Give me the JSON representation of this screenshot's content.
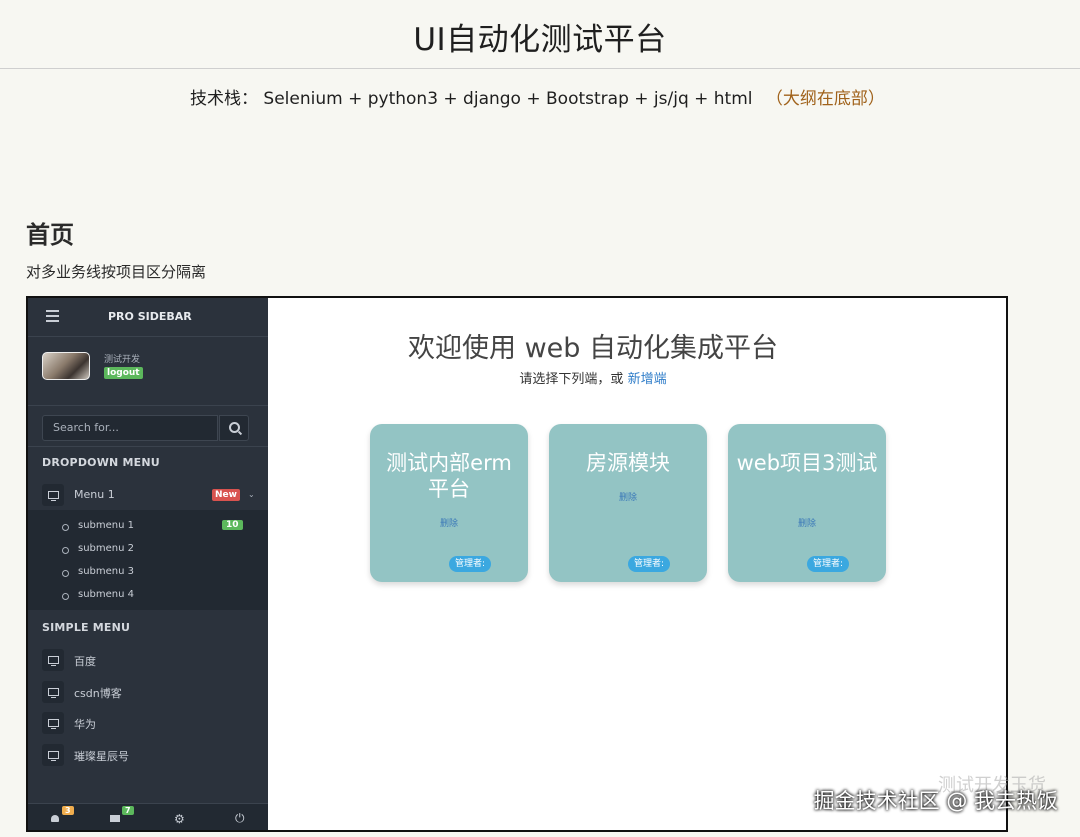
{
  "header": {
    "title": "UI自动化测试平台",
    "tech_label": "技术栈：",
    "tech_stack": "Selenium + python3 + django + Bootstrap + js/jq + html",
    "tech_note": "（大纲在底部）"
  },
  "section": {
    "heading": "首页",
    "description": "对多业务线按项目区分隔离"
  },
  "sidebar": {
    "brand": "PRO SIDEBAR",
    "user": {
      "name": "测试开发",
      "logout_label": "logout"
    },
    "search_placeholder": "Search for...",
    "dropdown_header": "DROPDOWN MENU",
    "menu1": {
      "label": "Menu 1",
      "badge": "New"
    },
    "submenu": [
      {
        "label": "submenu 1",
        "badge": "10"
      },
      {
        "label": "submenu 2"
      },
      {
        "label": "submenu 3"
      },
      {
        "label": "submenu 4"
      }
    ],
    "simple_header": "SIMPLE MENU",
    "simple_items": [
      {
        "label": "百度"
      },
      {
        "label": "csdn博客"
      },
      {
        "label": "华为"
      },
      {
        "label": "璀璨星辰号"
      }
    ],
    "footer": {
      "notifications_count": "3",
      "messages_count": "7"
    }
  },
  "main": {
    "title": "欢迎使用 web 自动化集成平台",
    "subtitle": "请选择下列端，或",
    "add_link": "新增端",
    "cards": [
      {
        "title": "测试内部erm平台",
        "delete_label": "删除",
        "admin_label": "管理者:"
      },
      {
        "title": "房源模块",
        "delete_label": "删除",
        "admin_label": "管理者:"
      },
      {
        "title": "web项目3测试",
        "delete_label": "删除",
        "admin_label": "管理者:"
      }
    ]
  },
  "watermark": {
    "faint": "测试开发玉货",
    "text": "掘金技术社区 @ 我去热饭"
  }
}
